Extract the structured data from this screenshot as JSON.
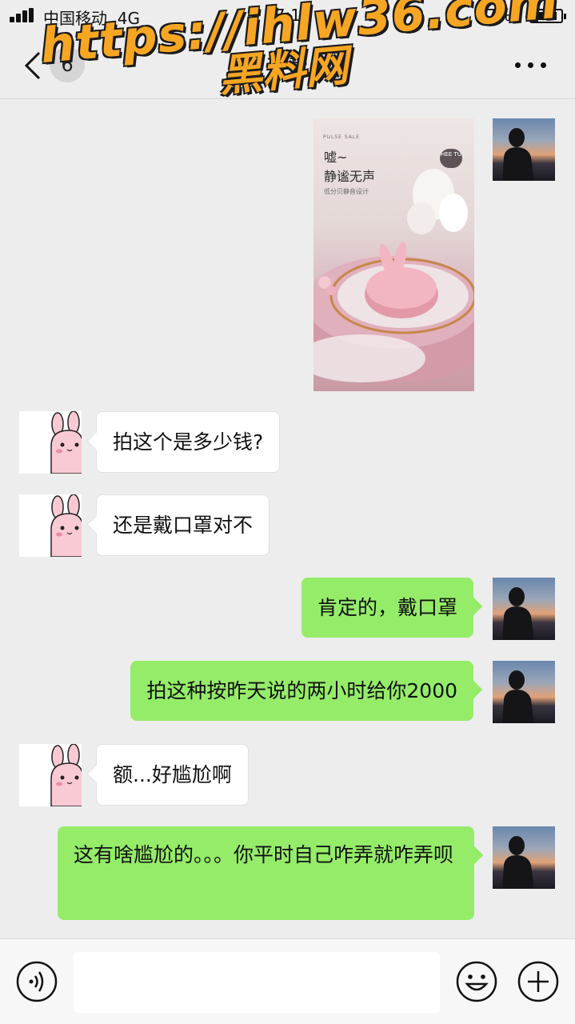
{
  "status_bar": {
    "carrier": "中国移动",
    "network": "4G",
    "time": "17:18",
    "battery_text": "7%",
    "battery_level": 0.87
  },
  "nav": {
    "unread_count": "6",
    "title": "可爱"
  },
  "watermark": {
    "url": "https://ihlw36.com",
    "name": "黑料网"
  },
  "image_message": {
    "tiny_text": "PULSE SALE",
    "headline_1": "嘘~",
    "headline_2": "静谧无声",
    "subline": "低分贝静音设计",
    "tag": "HEE TU"
  },
  "messages": [
    {
      "side": "left",
      "text": "拍这个是多少钱?"
    },
    {
      "side": "left",
      "text": "还是戴口罩对不"
    },
    {
      "side": "right",
      "text": "肯定的，戴口罩"
    },
    {
      "side": "right",
      "text": "拍这种按昨天说的两小时给你2000"
    },
    {
      "side": "left",
      "text": "额...好尴尬啊"
    },
    {
      "side": "right",
      "text": "这有啥尴尬的。。。你平时自己咋弄就咋弄呗"
    }
  ],
  "input": {
    "placeholder": ""
  },
  "icons": [
    "back-icon",
    "more-icon",
    "voice-icon",
    "emoji-icon",
    "plus-icon"
  ],
  "colors": {
    "background": "#ededed",
    "bubble_self": "#95ec69",
    "bubble_other": "#ffffff",
    "watermark": "#f6a623"
  }
}
